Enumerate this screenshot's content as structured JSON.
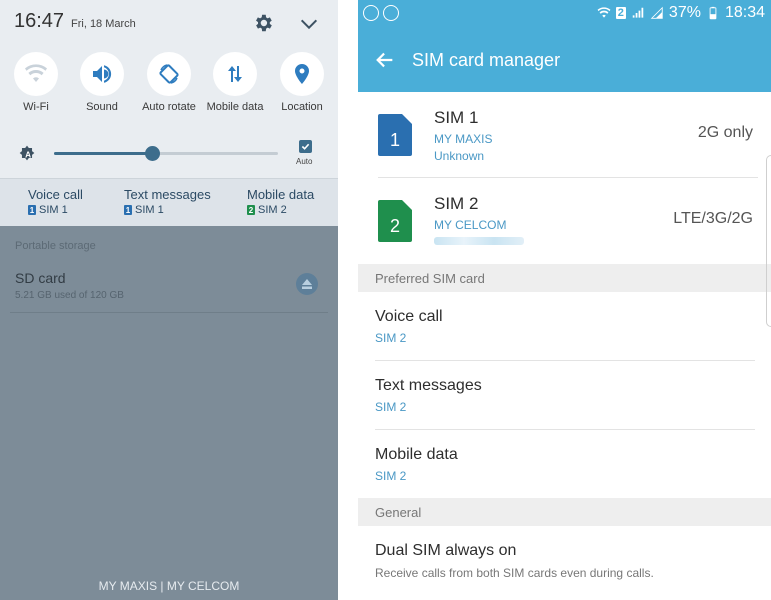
{
  "quick_settings": {
    "time": "16:47",
    "date": "Fri, 18 March",
    "tiles": [
      {
        "label": "Wi-Fi",
        "icon": "wifi-icon"
      },
      {
        "label": "Sound",
        "icon": "sound-icon"
      },
      {
        "label": "Auto rotate",
        "icon": "auto-rotate-icon"
      },
      {
        "label": "Mobile data",
        "icon": "mobile-data-icon"
      },
      {
        "label": "Location",
        "icon": "location-icon"
      }
    ],
    "brightness": {
      "level": 0.44,
      "auto_label": "Auto",
      "auto_checked": true
    },
    "sim_shortcuts": [
      {
        "title": "Voice call",
        "sim": "SIM 1",
        "badge": "1"
      },
      {
        "title": "Text messages",
        "sim": "SIM 1",
        "badge": "1"
      },
      {
        "title": "Mobile data",
        "sim": "SIM 2",
        "badge": "2"
      }
    ]
  },
  "notifications": {
    "portable_storage_label": "Portable storage",
    "sd_card": {
      "title": "SD card",
      "subtitle": "5.21 GB used of 120 GB"
    },
    "carrier_footer": "MY MAXIS | MY CELCOM"
  },
  "status_bar": {
    "sim_badge": "2",
    "battery": "37%",
    "time": "18:34"
  },
  "sim_manager": {
    "title": "SIM card manager",
    "sims": [
      {
        "name": "SIM 1",
        "number": "1",
        "carrier": "MY MAXIS",
        "sub": "Unknown",
        "network": "2G only",
        "color": "#2a6fb0"
      },
      {
        "name": "SIM 2",
        "number": "2",
        "carrier": "MY CELCOM",
        "sub": "",
        "network": "LTE/3G/2G",
        "color": "#1f8f4d"
      }
    ],
    "preferred_header": "Preferred SIM card",
    "preferred": [
      {
        "title": "Voice call",
        "value": "SIM 2"
      },
      {
        "title": "Text messages",
        "value": "SIM 2"
      },
      {
        "title": "Mobile data",
        "value": "SIM 2"
      }
    ],
    "general_header": "General",
    "dual_sim": {
      "title": "Dual SIM always on",
      "subtitle": "Receive calls from both SIM cards even during calls."
    }
  },
  "colors": {
    "accent": "#4aaed8",
    "link_blue": "#4a98c5",
    "sim1": "#2a6fb0",
    "sim2": "#1f8f4d",
    "panel_slider": "#3d6d8c"
  }
}
